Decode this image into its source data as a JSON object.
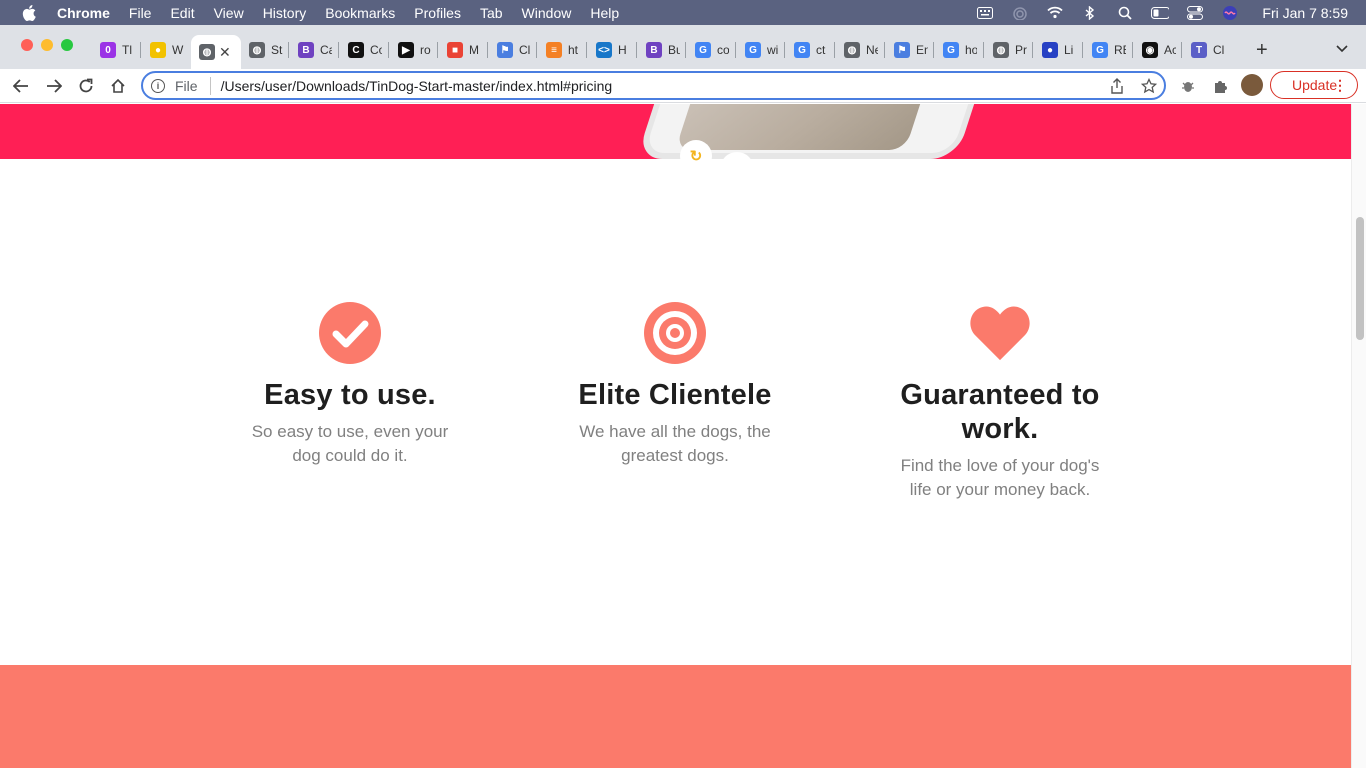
{
  "menubar": {
    "app": "Chrome",
    "items": [
      "File",
      "Edit",
      "View",
      "History",
      "Bookmarks",
      "Profiles",
      "Tab",
      "Window",
      "Help"
    ],
    "clock": "Fri Jan 7  8:59"
  },
  "tabs": [
    {
      "label": "Tl",
      "color": "#9b33e6",
      "glyph": "0"
    },
    {
      "label": "W",
      "color": "#f2c200",
      "glyph": "●"
    },
    {
      "label": "",
      "color": "#5f6368",
      "glyph": "◍"
    },
    {
      "label": "St",
      "color": "#5f6368",
      "glyph": "◍"
    },
    {
      "label": "Ca",
      "color": "#6f42c1",
      "glyph": "B"
    },
    {
      "label": "Co",
      "color": "#111111",
      "glyph": "C"
    },
    {
      "label": "ro",
      "color": "#111111",
      "glyph": "▶"
    },
    {
      "label": "M",
      "color": "#ea4335",
      "glyph": "■"
    },
    {
      "label": "Cl",
      "color": "#4a7ee0",
      "glyph": "⚑"
    },
    {
      "label": "ht",
      "color": "#f48024",
      "glyph": "≡"
    },
    {
      "label": "H",
      "color": "#1877c9",
      "glyph": "<>"
    },
    {
      "label": "Bu",
      "color": "#6f42c1",
      "glyph": "B"
    },
    {
      "label": "co",
      "color": "#4285f4",
      "glyph": "G"
    },
    {
      "label": "wi",
      "color": "#4285f4",
      "glyph": "G"
    },
    {
      "label": "ct",
      "color": "#4285f4",
      "glyph": "G"
    },
    {
      "label": "Ne",
      "color": "#5f6368",
      "glyph": "◍"
    },
    {
      "label": "En",
      "color": "#4a7ee0",
      "glyph": "⚑"
    },
    {
      "label": "ho",
      "color": "#4285f4",
      "glyph": "G"
    },
    {
      "label": "Pr",
      "color": "#5f6368",
      "glyph": "◍"
    },
    {
      "label": "Li",
      "color": "#2741c4",
      "glyph": "●"
    },
    {
      "label": "RE",
      "color": "#4285f4",
      "glyph": "G"
    },
    {
      "label": "Ac",
      "color": "#111111",
      "glyph": "◉"
    },
    {
      "label": "Cl",
      "color": "#5b5fc7",
      "glyph": "T"
    }
  ],
  "toolbar": {
    "scheme": "File",
    "url": "/Users/user/Downloads/TinDog-Start-master/index.html#pricing",
    "update_label": "Update"
  },
  "features": [
    {
      "icon": "check-circle-icon",
      "title": "Easy to use.",
      "text": "So easy to use, even your dog could do it."
    },
    {
      "icon": "bullseye-icon",
      "title": "Elite Clientele",
      "text": "We have all the dogs, the greatest dogs."
    },
    {
      "icon": "heart-icon",
      "title": "Guaranteed to work.",
      "text": "Find the love of your dog's life or your money back."
    }
  ],
  "colors": {
    "hero": "#ff1f55",
    "accent": "#fb7a6b",
    "heading": "#1f1f1f",
    "body_text": "#808080"
  }
}
